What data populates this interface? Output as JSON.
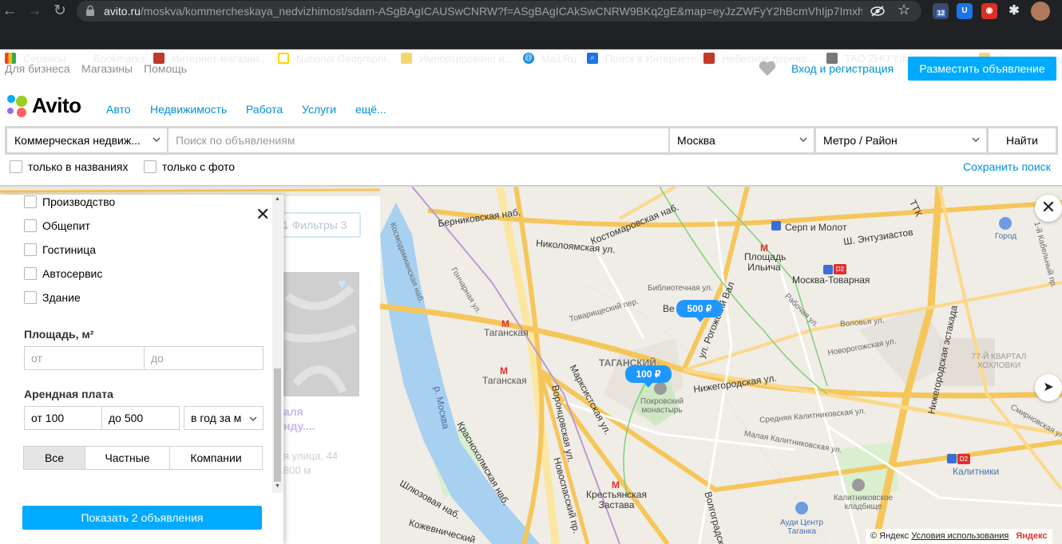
{
  "browser": {
    "url_host": "avito.ru",
    "url_path": "/moskva/kommercheskaya_nedvizhimost/sdam-ASgBAgICAUSwCNRW?f=ASgBAgICAkSwCNRW9BKq2gE&map=eyJzZWFyY2hBcmVhIjp7ImxhdE",
    "ext_badge": "12",
    "bookmarks": [
      "Сервисы",
      "Bookmarks",
      "Интернет-магазин...",
      "National Geographi...",
      "Импортировано и...",
      "Mail.Ru",
      "Поиск в Интернете",
      "Небесное дерево...",
      "TAO ZHU YIN YUA...",
      "»",
      "Другие заклад"
    ]
  },
  "topnav": {
    "links": [
      "Для бизнеса",
      "Магазины",
      "Помощь"
    ],
    "login": "Вход и регистрация",
    "post_ad": "Разместить объявление"
  },
  "header": {
    "logo": "Avito",
    "categories": [
      "Авто",
      "Недвижимость",
      "Работа",
      "Услуги",
      "ещё..."
    ]
  },
  "search": {
    "category": "Коммерческая недвиж...",
    "query_placeholder": "Поиск по объявлениям",
    "city": "Москва",
    "metro": "Метро / Район",
    "submit": "Найти",
    "only_titles": "только в названиях",
    "only_photo": "только с фото",
    "save": "Сохранить поиск"
  },
  "filters": {
    "types": [
      "Производство",
      "Общепит",
      "Гостиница",
      "Автосервис",
      "Здание"
    ],
    "area_label": "Площадь, м²",
    "area_from_placeholder": "от",
    "area_to_placeholder": "до",
    "rent_label": "Арендная плата",
    "rent_from": "от 100",
    "rent_to": "до 500",
    "rent_period": "в год за м",
    "seller_tabs": [
      "Все",
      "Частные",
      "Компании"
    ],
    "show_button": "Показать 2 объявления",
    "behind_filters_label": "Фильтры 3",
    "behind_listing_title": "аля\nнду....",
    "behind_listing_address": "я улица, 44",
    "behind_listing_distance": "800 м"
  },
  "map": {
    "pins": [
      "500 ₽",
      "100 ₽"
    ],
    "labels": [
      "Берниковская наб.",
      "Костомаровская наб.",
      "Николоямская ул.",
      "Гончарная ул.",
      "Библиотечная ул.",
      "Товарищеский пер.",
      "Таганская",
      "Таганская",
      "ТАГАНСКИЙ",
      "Покровский монастырь",
      "Марксистская ул.",
      "Воронцовская ул.",
      "Космодамианская наб.",
      "р. Москва",
      "Краснохолмская наб.",
      "Новоспасский пр.",
      "Шлюзовая наб.",
      "Крестьянская Застава",
      "Серп и Молот",
      "Площадь Ильича",
      "Москва-Товарная",
      "Ш. Энтузиастов",
      "Город",
      "ул. Рогожский Вал",
      "Нижегородская ул.",
      "Средняя Калитниковская ул.",
      "Малая Калитниковская ул.",
      "Калитниковское кладбище",
      "Ауди Центр Таганка",
      "Калитники",
      "Рабочая ул.",
      "Новорогожская ул.",
      "Воловья ул.",
      "Нижегородская эстакада",
      "77-Й КВАРТАЛ ХОХЛОВКИ",
      "1-й Кабельный пр.",
      "Смирновская ул.",
      "Волгоградский",
      "Кожевнический",
      "ТТК",
      "Ве"
    ],
    "copyright": "© Яндекс",
    "terms": "Условия использования",
    "yandex_logo": "Яндекс"
  },
  "colors": {
    "accent": "#00aaff",
    "link": "#0091d9",
    "pin": "#1e98ff"
  }
}
